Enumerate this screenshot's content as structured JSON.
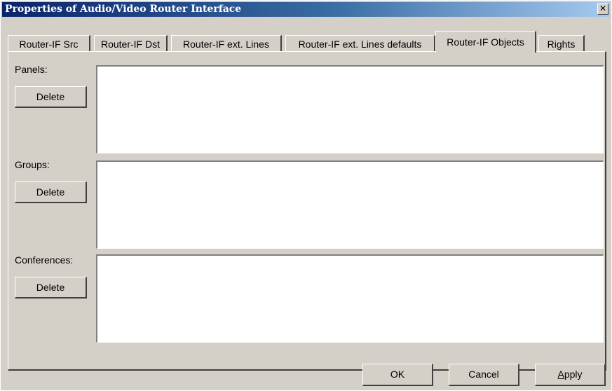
{
  "window": {
    "title": "Properties of Audio/Video Router Interface",
    "close_glyph": "✕"
  },
  "tabs": [
    {
      "label": "Router-IF Src",
      "active": false
    },
    {
      "label": "Router-IF Dst",
      "active": false
    },
    {
      "label": "Router-IF ext. Lines",
      "active": false
    },
    {
      "label": "Router-IF ext. Lines defaults",
      "active": false
    },
    {
      "label": "Router-IF Objects",
      "active": true
    },
    {
      "label": "Rights",
      "active": false
    }
  ],
  "sections": {
    "panels": {
      "label": "Panels:",
      "delete_label": "Delete"
    },
    "groups": {
      "label": "Groups:",
      "delete_label": "Delete"
    },
    "conferences": {
      "label": "Conferences:",
      "delete_label": "Delete"
    }
  },
  "footer": {
    "ok_label": "OK",
    "cancel_label": "Cancel",
    "apply_first": "A",
    "apply_rest": "pply"
  },
  "colors": {
    "face": "#d4d0c8",
    "title_start": "#0a246a",
    "title_end": "#a6caf0"
  }
}
